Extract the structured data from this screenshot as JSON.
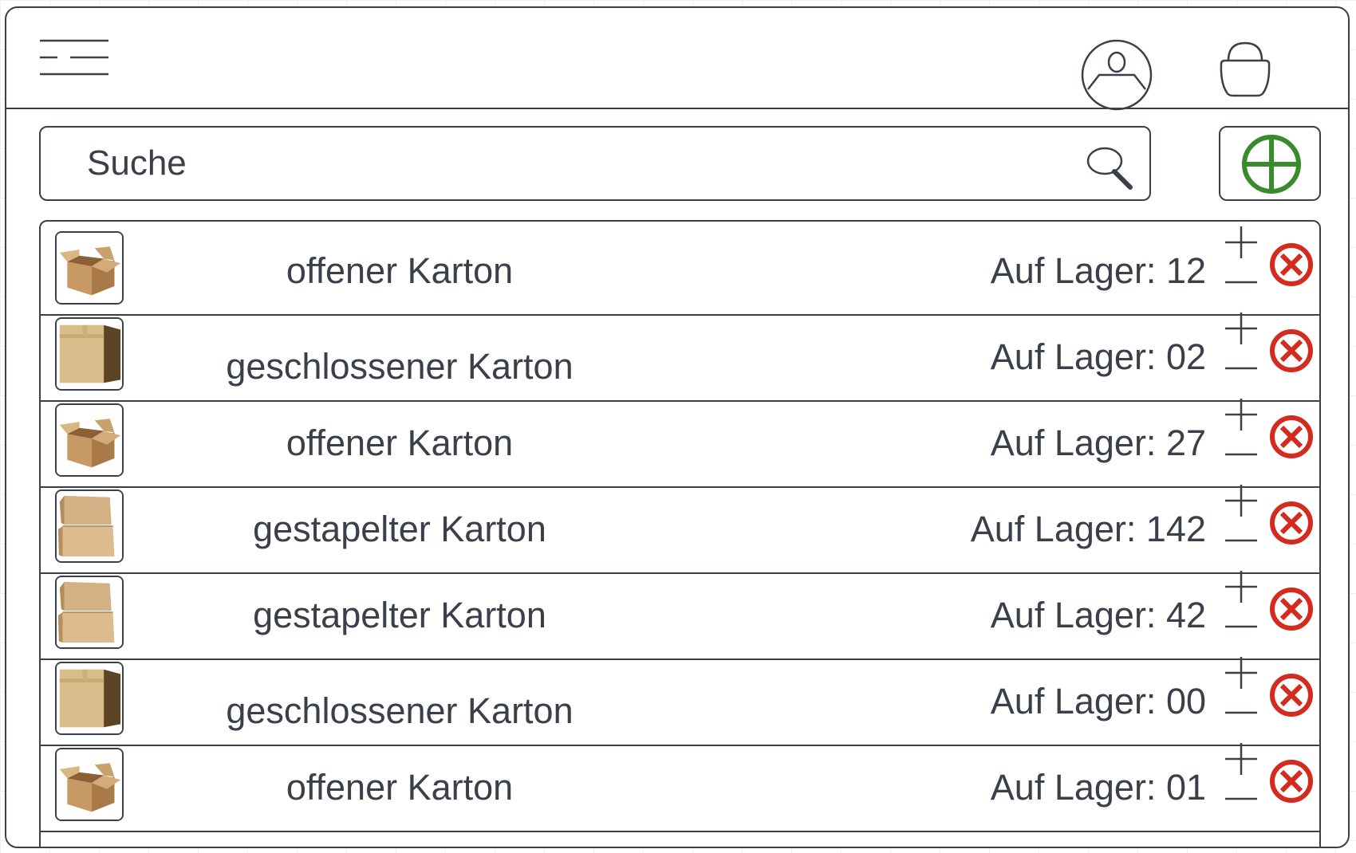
{
  "search": {
    "placeholder": "Suche"
  },
  "colors": {
    "accent_add": "#3a8a2e",
    "accent_delete": "#d52b1e",
    "outline": "#3a3f4a"
  },
  "icons": [
    "menu-icon",
    "profile-icon",
    "shopping-basket-icon",
    "search-icon",
    "add-circle-icon",
    "plus-icon",
    "minus-icon",
    "delete-icon"
  ],
  "products": [
    {
      "name": "offener Karton",
      "stock": "Auf Lager: 12",
      "image": "open-box"
    },
    {
      "name": "geschlossener Karton",
      "stock": "Auf Lager: 02",
      "image": "closed-box"
    },
    {
      "name": "offener Karton",
      "stock": "Auf Lager: 27",
      "image": "open-box"
    },
    {
      "name": "gestapelter Karton",
      "stock": "Auf Lager: 142",
      "image": "stacked-boxes"
    },
    {
      "name": "gestapelter Karton",
      "stock": "Auf Lager: 42",
      "image": "stacked-boxes"
    },
    {
      "name": "geschlossener Karton",
      "stock": "Auf Lager: 00",
      "image": "closed-box"
    },
    {
      "name": "offener Karton",
      "stock": "Auf Lager: 01",
      "image": "open-box"
    }
  ]
}
